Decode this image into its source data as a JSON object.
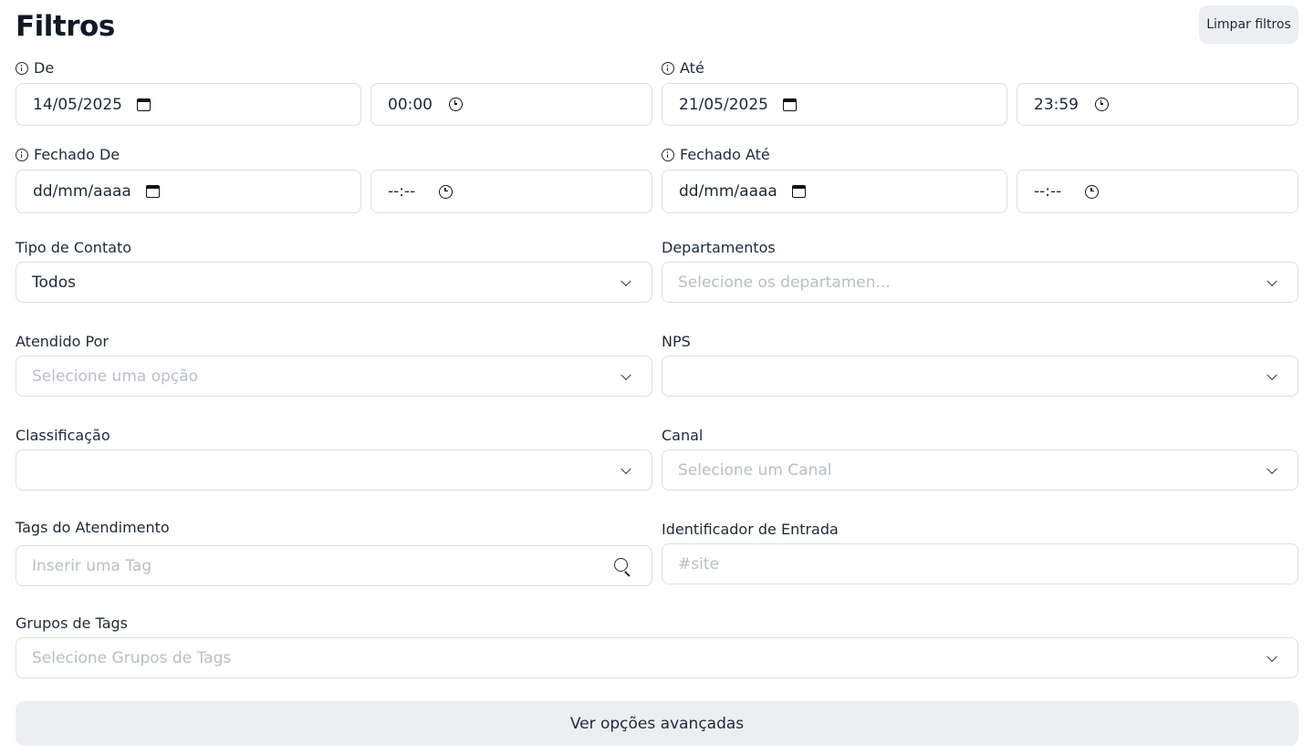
{
  "header": {
    "title": "Filtros",
    "clear_label": "Limpar filtros"
  },
  "de": {
    "label": "De",
    "date": "14/05/2025",
    "time": "00:00"
  },
  "ate": {
    "label": "Até",
    "date": "21/05/2025",
    "time": "23:59"
  },
  "fechado_de": {
    "label": "Fechado De",
    "date_placeholder": "dd/mm/aaaa",
    "time_placeholder": "--:--"
  },
  "fechado_ate": {
    "label": "Fechado Até",
    "date_placeholder": "dd/mm/aaaa",
    "time_placeholder": "--:--"
  },
  "tipo_contato": {
    "label": "Tipo de Contato",
    "value": "Todos"
  },
  "departamentos": {
    "label": "Departamentos",
    "placeholder": "Selecione os departamen..."
  },
  "atendido_por": {
    "label": "Atendido Por",
    "placeholder": "Selecione uma opção"
  },
  "nps": {
    "label": "NPS",
    "value": ""
  },
  "classificacao": {
    "label": "Classificação",
    "value": ""
  },
  "canal": {
    "label": "Canal",
    "placeholder": "Selecione um Canal"
  },
  "tags": {
    "label": "Tags do Atendimento",
    "placeholder": "Inserir uma Tag"
  },
  "identificador": {
    "label": "Identificador de Entrada",
    "placeholder": "#site"
  },
  "grupos_tags": {
    "label": "Grupos de Tags",
    "placeholder": "Selecione Grupos de Tags"
  },
  "footer": {
    "advanced_label": "Ver opções avançadas"
  },
  "icons": {
    "info": "info-icon",
    "calendar": "calendar-icon",
    "clock": "clock-icon",
    "chevron": "chevron-down-icon",
    "search": "search-icon"
  },
  "colors": {
    "border": "#dcdfe4",
    "placeholder": "#b9bec7",
    "button_bg": "#eceef1",
    "text": "#1f2937"
  }
}
